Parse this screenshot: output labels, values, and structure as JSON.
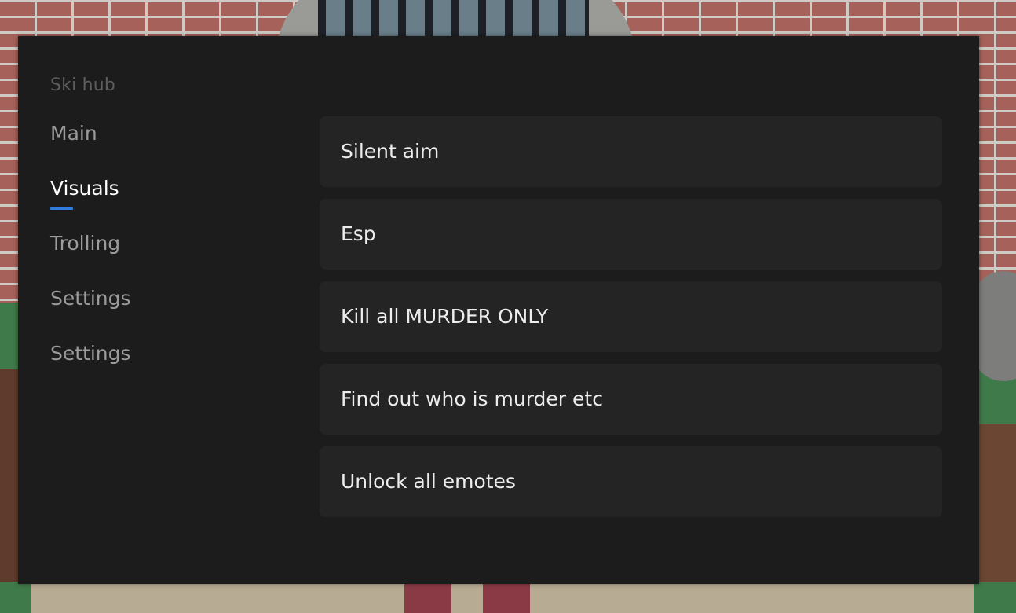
{
  "hub": {
    "title": "Ski hub",
    "active_tab": "Visuals",
    "accent_color": "#2f7de1",
    "tabs": [
      {
        "label": "Main"
      },
      {
        "label": "Visuals"
      },
      {
        "label": "Trolling"
      },
      {
        "label": "Settings"
      },
      {
        "label": "Settings"
      }
    ],
    "options": [
      {
        "label": "Silent aim"
      },
      {
        "label": "Esp"
      },
      {
        "label": "Kill all MURDER ONLY"
      },
      {
        "label": "Find out who is murder etc"
      },
      {
        "label": "Unlock all emotes"
      }
    ]
  }
}
